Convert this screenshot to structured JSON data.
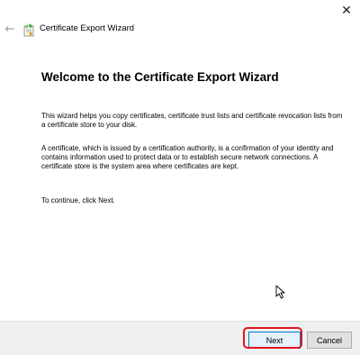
{
  "window": {
    "close_glyph": "✕",
    "back_glyph": "←",
    "title": "Certificate Export Wizard",
    "title_icon": "certificate-wizard-icon"
  },
  "content": {
    "heading": "Welcome to the Certificate Export Wizard",
    "paragraph1": "This wizard helps you copy certificates, certificate trust lists and certificate revocation lists from a certificate store to your disk.",
    "paragraph2": "A certificate, which is issued by a certification authority, is a confirmation of your identity and contains information used to protect data or to establish secure network connections. A certificate store is the system area where certificates are kept.",
    "paragraph3": "To continue, click Next."
  },
  "buttons": {
    "next_label": "Next",
    "cancel_label": "Cancel"
  },
  "colors": {
    "highlight": "#e0141e",
    "button_bar": "#f0f0f0",
    "focus_border": "#0078d7"
  }
}
